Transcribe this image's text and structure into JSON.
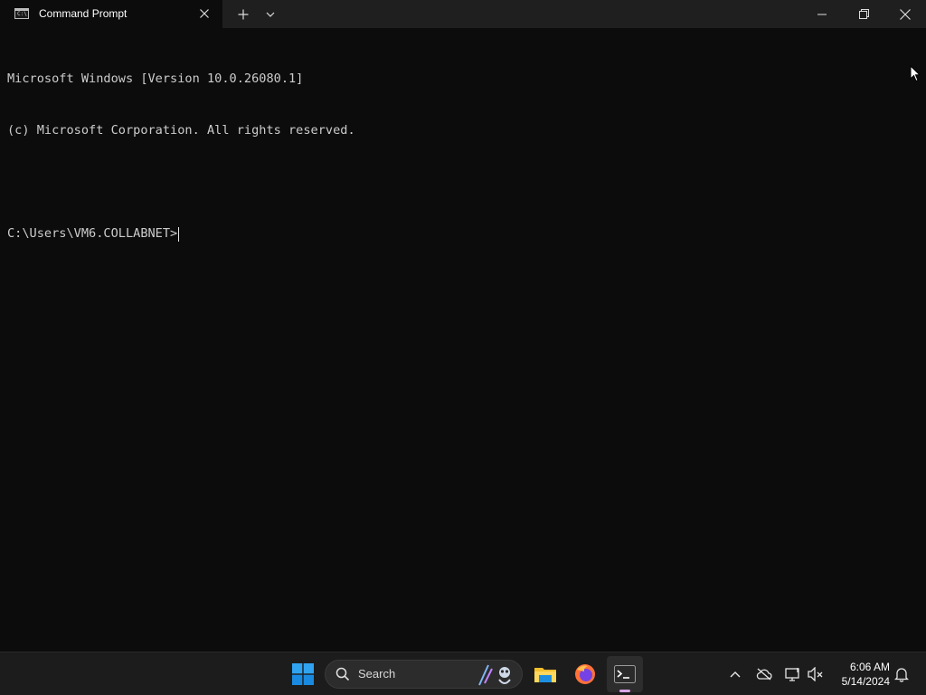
{
  "window": {
    "tab_title": "Command Prompt",
    "tab_icon_text": "C:\\"
  },
  "terminal": {
    "lines": [
      "Microsoft Windows [Version 10.0.26080.1]",
      "(c) Microsoft Corporation. All rights reserved.",
      ""
    ],
    "prompt": "C:\\Users\\VM6.COLLABNET>"
  },
  "taskbar": {
    "search_label": "Search",
    "apps": [
      "file-explorer",
      "firefox",
      "terminal"
    ],
    "clock_time": "6:06 AM",
    "clock_date": "5/14/2024"
  },
  "colors": {
    "terminal_bg": "#0c0c0c",
    "titlebar_bg": "#1f1f1f",
    "taskbar_bg": "#1c1c1c",
    "text": "#cccccc",
    "accent": "#0078d4"
  }
}
